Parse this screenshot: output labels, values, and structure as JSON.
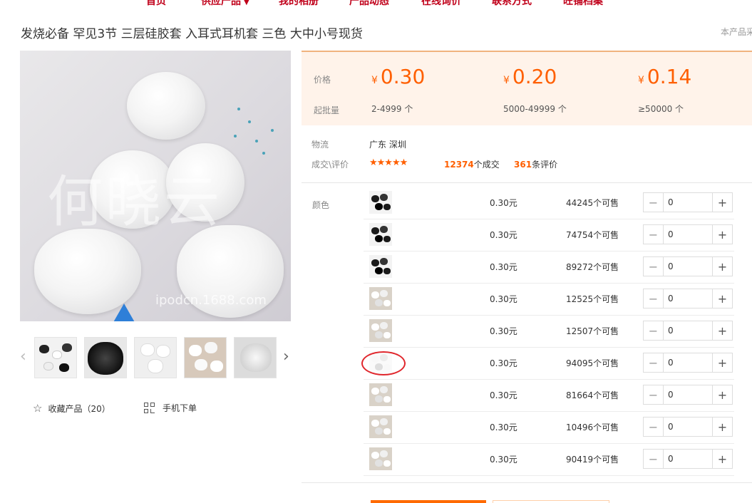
{
  "nav": {
    "items": [
      "首页",
      "供应产品",
      "我的相册",
      "产品动态",
      "在线询价",
      "联系方式",
      "旺铺档案"
    ]
  },
  "product": {
    "title": "发烧必备 罕见3节 三层硅胶套 入耳式耳机套 三色 大中小号现货",
    "note": "本产品采"
  },
  "image": {
    "watermark": "何晓云",
    "watermark_url": "ipodcn.1688.com"
  },
  "actions": {
    "favorite_label": "收藏产品（20）",
    "mobile_order_label": "手机下单"
  },
  "pricing": {
    "price_label": "价格",
    "moq_label": "起批量",
    "currency": "¥",
    "tiers": [
      {
        "price": "0.30",
        "range": "2-4999 个"
      },
      {
        "price": "0.20",
        "range": "5000-49999 个"
      },
      {
        "price": "0.14",
        "range": "≥50000 个"
      }
    ]
  },
  "logistics": {
    "label": "物流",
    "value": "广东 深圳"
  },
  "reviews": {
    "label": "成交\\评价",
    "stars": "★★★★★",
    "deals_count": "12374",
    "deals_suffix": "个成交",
    "review_count": "361",
    "review_suffix": "条评价"
  },
  "color_label": "颜色",
  "skus": [
    {
      "price": "0.30元",
      "stock": "44245个可售",
      "qty": "0",
      "tone": "black"
    },
    {
      "price": "0.30元",
      "stock": "74754个可售",
      "qty": "0",
      "tone": "black"
    },
    {
      "price": "0.30元",
      "stock": "89272个可售",
      "qty": "0",
      "tone": "black"
    },
    {
      "price": "0.30元",
      "stock": "12525个可售",
      "qty": "0",
      "tone": "white"
    },
    {
      "price": "0.30元",
      "stock": "12507个可售",
      "qty": "0",
      "tone": "white"
    },
    {
      "price": "0.30元",
      "stock": "94095个可售",
      "qty": "0",
      "tone": "clear"
    },
    {
      "price": "0.30元",
      "stock": "81664个可售",
      "qty": "0",
      "tone": "white"
    },
    {
      "price": "0.30元",
      "stock": "10496个可售",
      "qty": "0",
      "tone": "white"
    },
    {
      "price": "0.30元",
      "stock": "90419个可售",
      "qty": "0",
      "tone": "white"
    }
  ],
  "colors": {
    "accent": "#ff5f00",
    "nav_red": "#c0001a",
    "highlight_circle": "#e0262c"
  }
}
